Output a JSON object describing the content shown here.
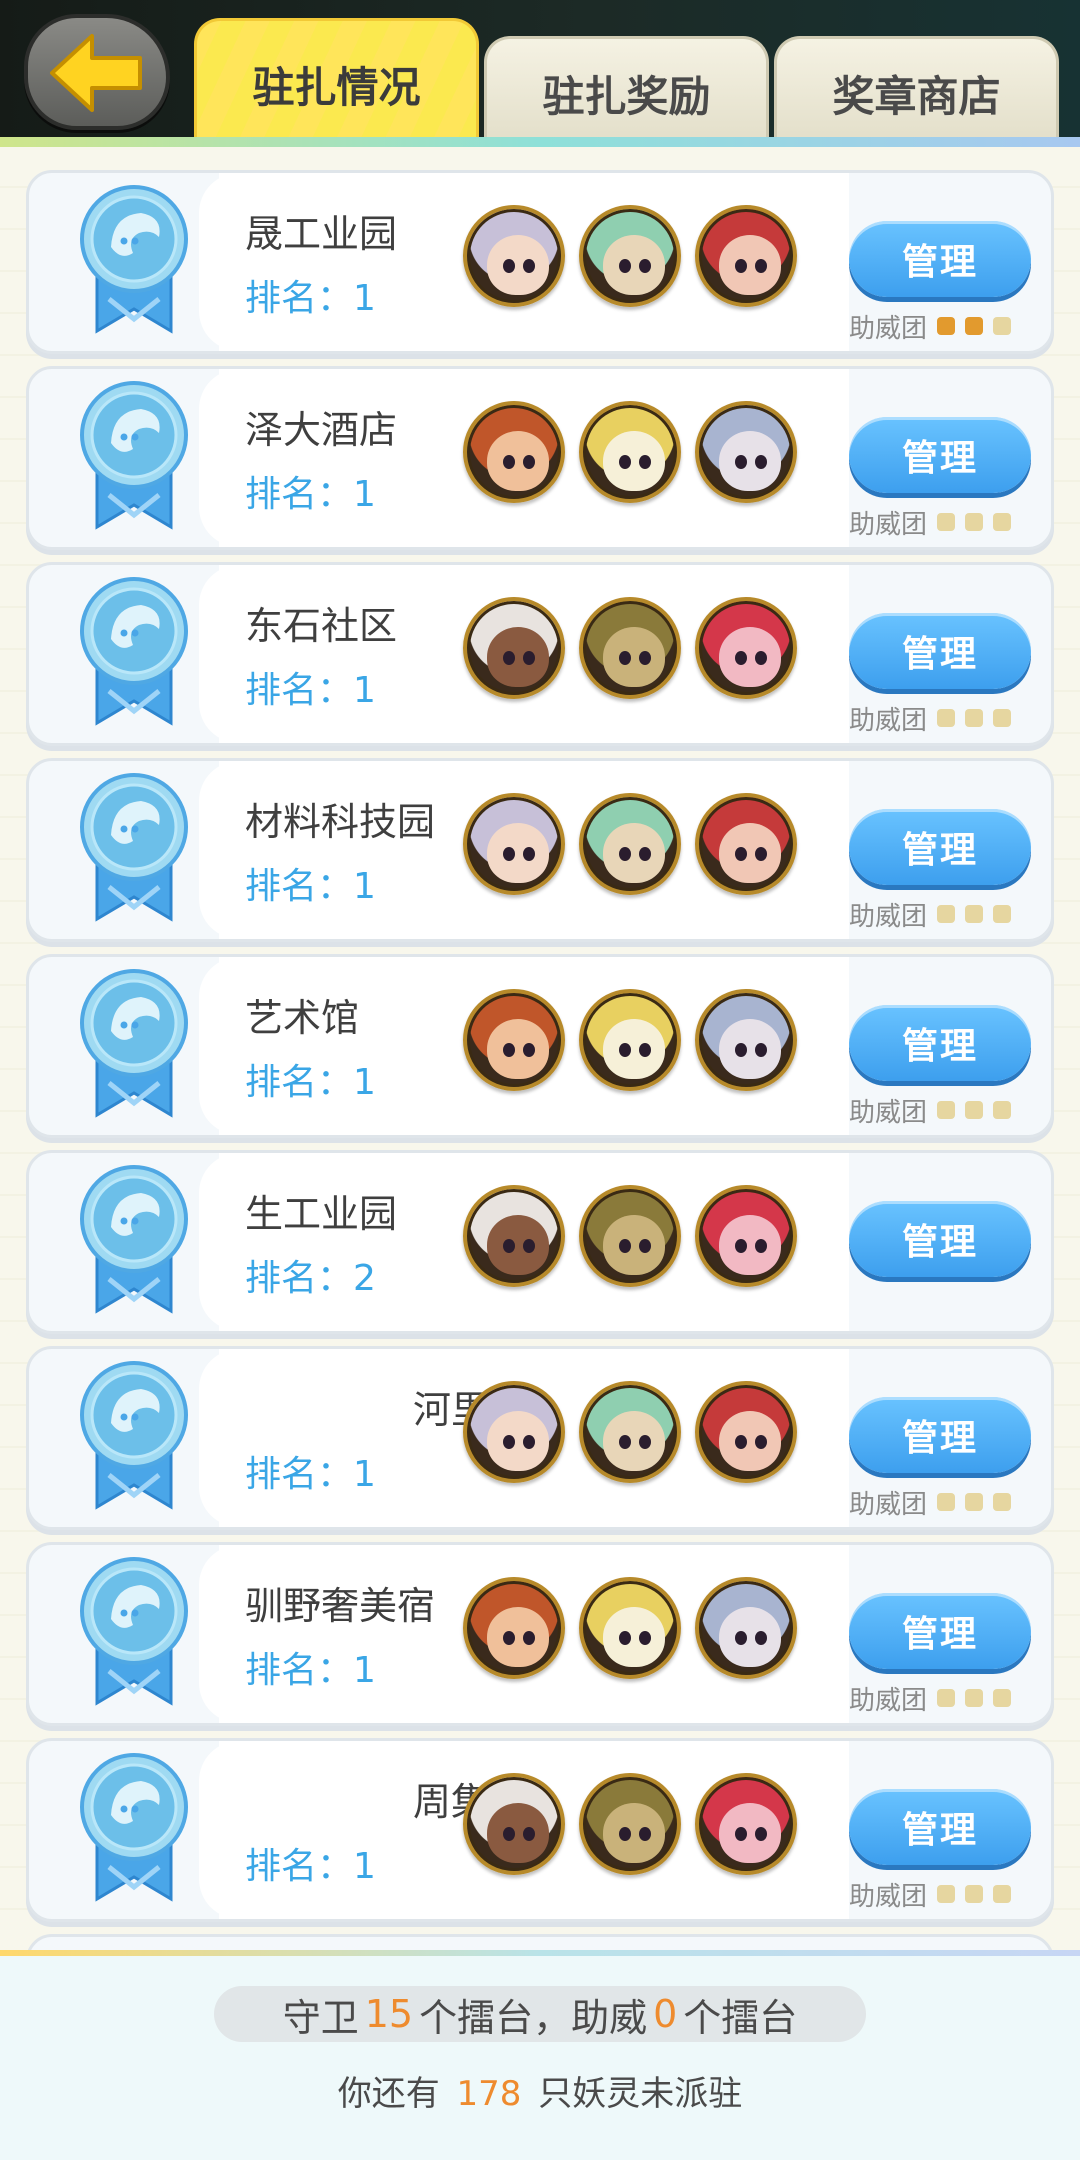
{
  "tabs": [
    {
      "label": "驻扎情况",
      "active": true
    },
    {
      "label": "驻扎奖励",
      "active": false
    },
    {
      "label": "奖章商店",
      "active": false
    }
  ],
  "rank_label": "排名：",
  "manage_label": "管理",
  "helper_label": "助威团",
  "colors": {
    "accent_blue": "#3d9fee",
    "rank_blue": "#3aa6e6",
    "highlight_orange": "#ee8b2e",
    "active_tab_yellow": "#ffe55a"
  },
  "stations": [
    {
      "name": "晟工业园",
      "rank": "1",
      "name_align": "left",
      "helper_active": 2,
      "show_helper": true,
      "avatars": [
        "silver-fox-girl-avatar",
        "green-haired-girl-avatar",
        "horned-red-demon-avatar"
      ]
    },
    {
      "name": "泽大酒店",
      "rank": "1",
      "name_align": "left",
      "helper_active": 0,
      "show_helper": true,
      "avatars": [
        "orange-beast-boy-avatar",
        "sunglasses-chick-avatar",
        "white-wolf-avatar"
      ]
    },
    {
      "name": "东石社区",
      "rank": "1",
      "name_align": "left",
      "helper_active": 0,
      "show_helper": true,
      "avatars": [
        "white-haired-girl-avatar",
        "cyclops-rock-avatar",
        "pink-cat-girl-avatar"
      ]
    },
    {
      "name": "材料科技园",
      "rank": "1",
      "name_align": "left",
      "helper_active": 0,
      "show_helper": true,
      "avatars": [
        "lion-warrior-avatar",
        "golden-knight-avatar",
        "shiba-dog-avatar"
      ]
    },
    {
      "name": "艺术馆",
      "rank": "1",
      "name_align": "left",
      "helper_active": 0,
      "show_helper": true,
      "avatars": [
        "pink-haired-girl-avatar",
        "hooded-mage-avatar",
        "grey-wolf-girl-avatar"
      ]
    },
    {
      "name": "生工业园",
      "rank": "2",
      "name_align": "left",
      "helper_active": 0,
      "show_helper": false,
      "avatars": [
        "lion-dance-avatar",
        "pharaoh-girl-avatar",
        "mouse-girl-avatar"
      ]
    },
    {
      "name": "河里",
      "rank": "1",
      "name_align": "right",
      "helper_active": 0,
      "show_helper": true,
      "avatars": [
        "golden-helmet-avatar",
        "teal-haired-girl-avatar",
        "red-dragon-avatar"
      ]
    },
    {
      "name": "驯野奢美宿",
      "rank": "1",
      "name_align": "left",
      "helper_active": 0,
      "show_helper": true,
      "avatars": [
        "mint-haired-girl-avatar",
        "deer-girl-avatar",
        "red-panda-avatar"
      ]
    },
    {
      "name": "周集",
      "rank": "1",
      "name_align": "right",
      "helper_active": 0,
      "show_helper": true,
      "avatars": [
        "crowned-fairy-avatar",
        "purple-priestess-avatar",
        "crimson-beast-avatar"
      ]
    }
  ],
  "footer": {
    "guard_prefix": "守卫",
    "guard_count": "15",
    "guard_mid": "个擂台，助威",
    "cheer_count": "0",
    "guard_suffix": "个擂台",
    "remain_prefix": "你还有",
    "remain_count": "178",
    "remain_suffix": "只妖灵未派驻"
  }
}
